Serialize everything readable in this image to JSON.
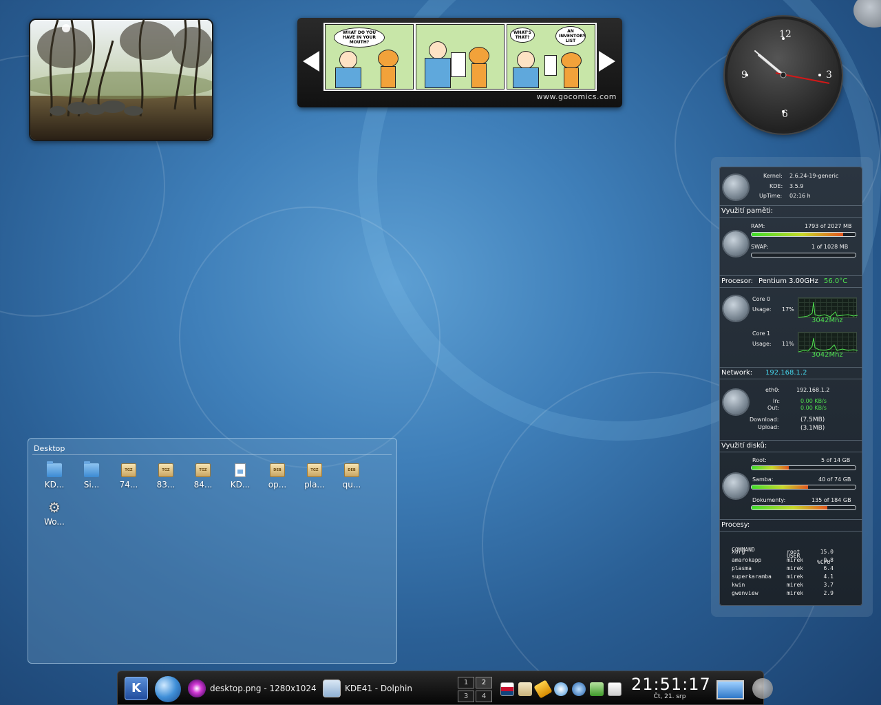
{
  "comic": {
    "panel1_bubble": "WHAT DO YOU HAVE IN YOUR MOUTH?",
    "panel3_bubble_jon": "WHAT'S THAT?",
    "panel3_bubble_garfield": "AN INVENTORY LIST",
    "source_url": "www.gocomics.com"
  },
  "clock": {
    "numbers": [
      "12",
      "3",
      "6",
      "9"
    ]
  },
  "sysmon": {
    "kernel_label": "Kernel:",
    "kernel_value": "2.6.24-19-generic",
    "kde_label": "KDE:",
    "kde_value": "3.5.9",
    "uptime_label": "UpTime:",
    "uptime_value": "02:16 h",
    "memory_title": "Využití paměti:",
    "ram_label": "RAM:",
    "ram_value": "1793 of 2027 MB",
    "ram_fraction": 0.88,
    "swap_label": "SWAP:",
    "swap_value": "1 of 1028 MB",
    "swap_fraction": 0.001,
    "cpu_title": "Procesor:",
    "cpu_name": "Pentium 3.00GHz",
    "cpu_temp": "56.0°C",
    "core0_label": "Core 0",
    "core0_usage_label": "Usage:",
    "core0_usage": "17%",
    "core0_freq": "3042Mhz",
    "core1_label": "Core 1",
    "core1_usage_label": "Usage:",
    "core1_usage": "11%",
    "core1_freq": "3042Mhz",
    "network_title": "Network:",
    "network_ip": "192.168.1.2",
    "eth_label": "eth0:",
    "eth_ip": "192.168.1.2",
    "in_label": "In:",
    "in_value": "0.00 KB/s",
    "out_label": "Out:",
    "out_value": "0.00 KB/s",
    "download_label": "Download:",
    "download_value": "(7.5MB)",
    "upload_label": "Upload:",
    "upload_value": "(3.1MB)",
    "disk_title": "Využití disků:",
    "root_label": "Root:",
    "root_value": "5 of 14 GB",
    "root_fraction": 0.36,
    "samba_label": "Samba:",
    "samba_value": "40 of 74 GB",
    "samba_fraction": 0.54,
    "docs_label": "Dokumenty:",
    "docs_value": "135 of 184 GB",
    "docs_fraction": 0.73,
    "proc_title": "Procesy:",
    "proc_header": [
      "COMMAND",
      "USER",
      "%CPU"
    ],
    "processes": [
      [
        "Xorg",
        "root",
        "15.0"
      ],
      [
        "amarokapp",
        "mirek",
        "9.8"
      ],
      [
        "plasma",
        "mirek",
        "6.4"
      ],
      [
        "superkaramba",
        "mirek",
        "4.1"
      ],
      [
        "kwin",
        "mirek",
        "3.7"
      ],
      [
        "gwenview",
        "mirek",
        "2.9"
      ]
    ]
  },
  "folderview": {
    "title": "Desktop",
    "items": [
      {
        "label": "KD...",
        "icon": "folder-icon"
      },
      {
        "label": "Si...",
        "icon": "folder-icon"
      },
      {
        "label": "74...",
        "icon": "tgz-archive-icon",
        "badge": "TGZ"
      },
      {
        "label": "83...",
        "icon": "tgz-archive-icon",
        "badge": "TGZ"
      },
      {
        "label": "84...",
        "icon": "tgz-archive-icon",
        "badge": "TGZ"
      },
      {
        "label": "KD...",
        "icon": "document-icon"
      },
      {
        "label": "op...",
        "icon": "deb-package-icon",
        "badge": "DEB"
      },
      {
        "label": "pla...",
        "icon": "tgz-archive-icon",
        "badge": "TGZ"
      },
      {
        "label": "qu...",
        "icon": "deb-package-icon",
        "badge": "DEB"
      },
      {
        "label": "Wo...",
        "icon": "gear-icon"
      }
    ]
  },
  "taskbar": {
    "launcher_label": "K",
    "tasks": [
      {
        "label": "desktop.png - 1280x1024",
        "icon": "gwenview-icon"
      },
      {
        "label": "KDE41 - Dolphin",
        "icon": "dolphin-icon"
      }
    ],
    "pager": [
      "1",
      "2",
      "3",
      "4"
    ],
    "tray_icons": [
      "keyboard-layout-icon",
      "clipboard-icon",
      "updates-icon",
      "network-icon",
      "amarok-icon",
      "kopete-icon",
      "mail-icon"
    ],
    "time": "21:51:17",
    "date": "Čt, 21. srp"
  }
}
